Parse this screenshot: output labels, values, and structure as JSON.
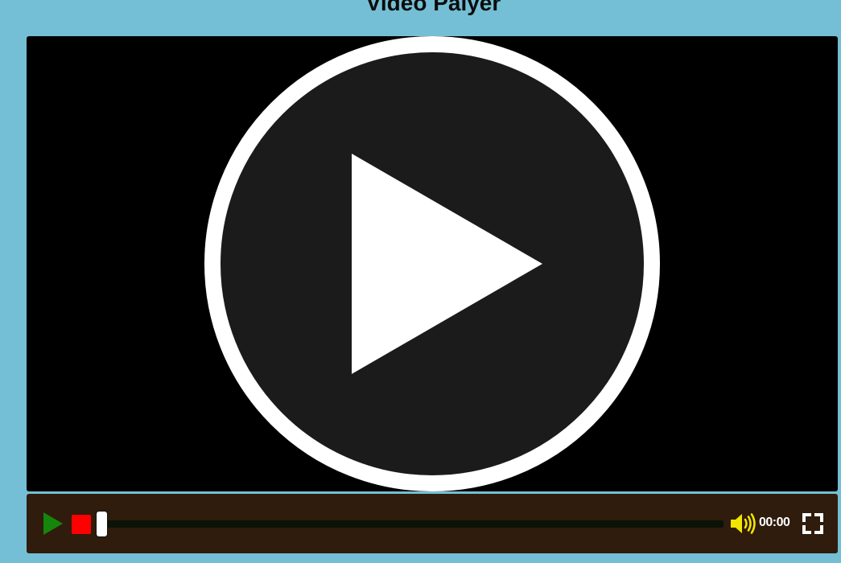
{
  "page": {
    "title": "Video Palyer"
  },
  "player": {
    "current_time": "00:00",
    "progress": 0.0,
    "colors": {
      "play": "#15860b",
      "stop": "#ff0000",
      "volume": "#f2e600",
      "controls_bg": "#2f1c0c",
      "screen_bg": "#000000",
      "page_bg": "#74bfd5"
    },
    "icons": {
      "overlay": "play-circle-icon",
      "play": "play-icon",
      "stop": "stop-icon",
      "volume": "volume-icon",
      "fullscreen": "fullscreen-icon"
    }
  }
}
